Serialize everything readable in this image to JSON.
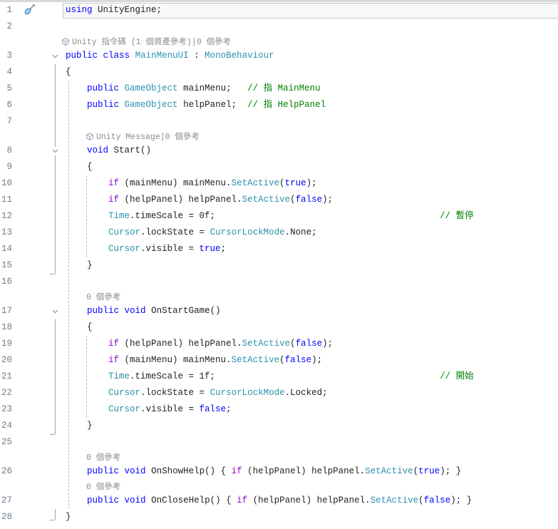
{
  "editor": {
    "colors": {
      "background": "#ffffff",
      "keyword": "#0000ff",
      "control_keyword": "#8f08c4",
      "type_name": "#2b91af",
      "comment": "#008000",
      "plain_text": "#1f1f1f",
      "line_number": "#6e7e8c",
      "codelens_text": "#8c8c8c",
      "current_line_fill": "#f8f8f9",
      "current_line_border": "#c9c9c9"
    },
    "icons": {
      "glyph_margin": "screwdriver-quick-actions-icon",
      "codelens": "unity-cube-icon",
      "fold": "chevron-down-icon"
    },
    "rows": [
      {
        "kind": "code",
        "num": "1",
        "glyph": true,
        "current": true,
        "segs": [
          [
            "k",
            "using"
          ],
          [
            "p",
            " UnityEngine;"
          ]
        ]
      },
      {
        "kind": "code",
        "num": "2",
        "segs": []
      },
      {
        "kind": "lens",
        "icon": true,
        "indent": 0,
        "text": "Unity 指令碼 (1 個資產參考)|0 個參考"
      },
      {
        "kind": "code",
        "num": "3",
        "fold": "chev",
        "segs": [
          [
            "k",
            "public"
          ],
          [
            "p",
            " "
          ],
          [
            "k",
            "class"
          ],
          [
            "p",
            " "
          ],
          [
            "t",
            "MainMenuUI"
          ],
          [
            "p",
            " : "
          ],
          [
            "t",
            "MonoBehaviour"
          ]
        ]
      },
      {
        "kind": "code",
        "num": "4",
        "segs": [
          [
            "p",
            "{"
          ]
        ]
      },
      {
        "kind": "code",
        "num": "5",
        "segs": [
          [
            "p",
            "    "
          ],
          [
            "k",
            "public"
          ],
          [
            "p",
            " "
          ],
          [
            "t",
            "GameObject"
          ],
          [
            "p",
            " mainMenu;   "
          ],
          [
            "g",
            "// 指 MainMenu"
          ]
        ]
      },
      {
        "kind": "code",
        "num": "6",
        "segs": [
          [
            "p",
            "    "
          ],
          [
            "k",
            "public"
          ],
          [
            "p",
            " "
          ],
          [
            "t",
            "GameObject"
          ],
          [
            "p",
            " helpPanel;  "
          ],
          [
            "g",
            "// 指 HelpPanel"
          ]
        ]
      },
      {
        "kind": "code",
        "num": "7",
        "segs": []
      },
      {
        "kind": "lens",
        "icon": true,
        "indent": 4,
        "text": "Unity Message|0 個參考"
      },
      {
        "kind": "code",
        "num": "8",
        "fold": "chev",
        "segs": [
          [
            "p",
            "    "
          ],
          [
            "k",
            "void"
          ],
          [
            "p",
            " Start()"
          ]
        ]
      },
      {
        "kind": "code",
        "num": "9",
        "segs": [
          [
            "p",
            "    {"
          ]
        ]
      },
      {
        "kind": "code",
        "num": "10",
        "segs": [
          [
            "p",
            "        "
          ],
          [
            "c",
            "if"
          ],
          [
            "p",
            " (mainMenu) mainMenu."
          ],
          [
            "t",
            "SetActive"
          ],
          [
            "p",
            "("
          ],
          [
            "k",
            "true"
          ],
          [
            "p",
            ");"
          ]
        ]
      },
      {
        "kind": "code",
        "num": "11",
        "segs": [
          [
            "p",
            "        "
          ],
          [
            "c",
            "if"
          ],
          [
            "p",
            " (helpPanel) helpPanel."
          ],
          [
            "t",
            "SetActive"
          ],
          [
            "p",
            "("
          ],
          [
            "k",
            "false"
          ],
          [
            "p",
            ");"
          ]
        ]
      },
      {
        "kind": "code",
        "num": "12",
        "segs": [
          [
            "p",
            "        "
          ],
          [
            "t",
            "Time"
          ],
          [
            "p",
            ".timeScale = 0f;"
          ],
          [
            "w",
            "42"
          ],
          [
            "g",
            "// 暫停"
          ]
        ]
      },
      {
        "kind": "code",
        "num": "13",
        "segs": [
          [
            "p",
            "        "
          ],
          [
            "t",
            "Cursor"
          ],
          [
            "p",
            ".lockState = "
          ],
          [
            "t",
            "CursorLockMode"
          ],
          [
            "p",
            ".None;"
          ]
        ]
      },
      {
        "kind": "code",
        "num": "14",
        "segs": [
          [
            "p",
            "        "
          ],
          [
            "t",
            "Cursor"
          ],
          [
            "p",
            ".visible = "
          ],
          [
            "k",
            "true"
          ],
          [
            "p",
            ";"
          ]
        ]
      },
      {
        "kind": "code",
        "num": "15",
        "segs": [
          [
            "p",
            "    }"
          ]
        ]
      },
      {
        "kind": "code",
        "num": "16",
        "segs": []
      },
      {
        "kind": "lens",
        "icon": false,
        "indent": 4,
        "text": "0 個參考"
      },
      {
        "kind": "code",
        "num": "17",
        "fold": "chev",
        "segs": [
          [
            "p",
            "    "
          ],
          [
            "k",
            "public"
          ],
          [
            "p",
            " "
          ],
          [
            "k",
            "void"
          ],
          [
            "p",
            " OnStartGame()"
          ]
        ]
      },
      {
        "kind": "code",
        "num": "18",
        "segs": [
          [
            "p",
            "    {"
          ]
        ]
      },
      {
        "kind": "code",
        "num": "19",
        "segs": [
          [
            "p",
            "        "
          ],
          [
            "c",
            "if"
          ],
          [
            "p",
            " (helpPanel) helpPanel."
          ],
          [
            "t",
            "SetActive"
          ],
          [
            "p",
            "("
          ],
          [
            "k",
            "false"
          ],
          [
            "p",
            ");"
          ]
        ]
      },
      {
        "kind": "code",
        "num": "20",
        "segs": [
          [
            "p",
            "        "
          ],
          [
            "c",
            "if"
          ],
          [
            "p",
            " (mainMenu) mainMenu."
          ],
          [
            "t",
            "SetActive"
          ],
          [
            "p",
            "("
          ],
          [
            "k",
            "false"
          ],
          [
            "p",
            ");"
          ]
        ]
      },
      {
        "kind": "code",
        "num": "21",
        "segs": [
          [
            "p",
            "        "
          ],
          [
            "t",
            "Time"
          ],
          [
            "p",
            ".timeScale = 1f;"
          ],
          [
            "w",
            "42"
          ],
          [
            "g",
            "// 開始"
          ]
        ]
      },
      {
        "kind": "code",
        "num": "22",
        "segs": [
          [
            "p",
            "        "
          ],
          [
            "t",
            "Cursor"
          ],
          [
            "p",
            ".lockState = "
          ],
          [
            "t",
            "CursorLockMode"
          ],
          [
            "p",
            ".Locked;"
          ]
        ]
      },
      {
        "kind": "code",
        "num": "23",
        "segs": [
          [
            "p",
            "        "
          ],
          [
            "t",
            "Cursor"
          ],
          [
            "p",
            ".visible = "
          ],
          [
            "k",
            "false"
          ],
          [
            "p",
            ";"
          ]
        ]
      },
      {
        "kind": "code",
        "num": "24",
        "segs": [
          [
            "p",
            "    }"
          ]
        ]
      },
      {
        "kind": "code",
        "num": "25",
        "segs": []
      },
      {
        "kind": "lens",
        "icon": false,
        "indent": 4,
        "text": "0 個參考"
      },
      {
        "kind": "code",
        "num": "26",
        "segs": [
          [
            "p",
            "    "
          ],
          [
            "k",
            "public"
          ],
          [
            "p",
            " "
          ],
          [
            "k",
            "void"
          ],
          [
            "p",
            " OnShowHelp() { "
          ],
          [
            "c",
            "if"
          ],
          [
            "p",
            " (helpPanel) helpPanel."
          ],
          [
            "t",
            "SetActive"
          ],
          [
            "p",
            "("
          ],
          [
            "k",
            "true"
          ],
          [
            "p",
            "); }"
          ]
        ]
      },
      {
        "kind": "lens",
        "icon": false,
        "indent": 4,
        "text": "0 個參考"
      },
      {
        "kind": "code",
        "num": "27",
        "segs": [
          [
            "p",
            "    "
          ],
          [
            "k",
            "public"
          ],
          [
            "p",
            " "
          ],
          [
            "k",
            "void"
          ],
          [
            "p",
            " OnCloseHelp() { "
          ],
          [
            "c",
            "if"
          ],
          [
            "p",
            " (helpPanel) helpPanel."
          ],
          [
            "t",
            "SetActive"
          ],
          [
            "p",
            "("
          ],
          [
            "k",
            "false"
          ],
          [
            "p",
            "); }"
          ]
        ]
      },
      {
        "kind": "code",
        "num": "28",
        "segs": [
          [
            "p",
            "}"
          ]
        ]
      }
    ]
  }
}
